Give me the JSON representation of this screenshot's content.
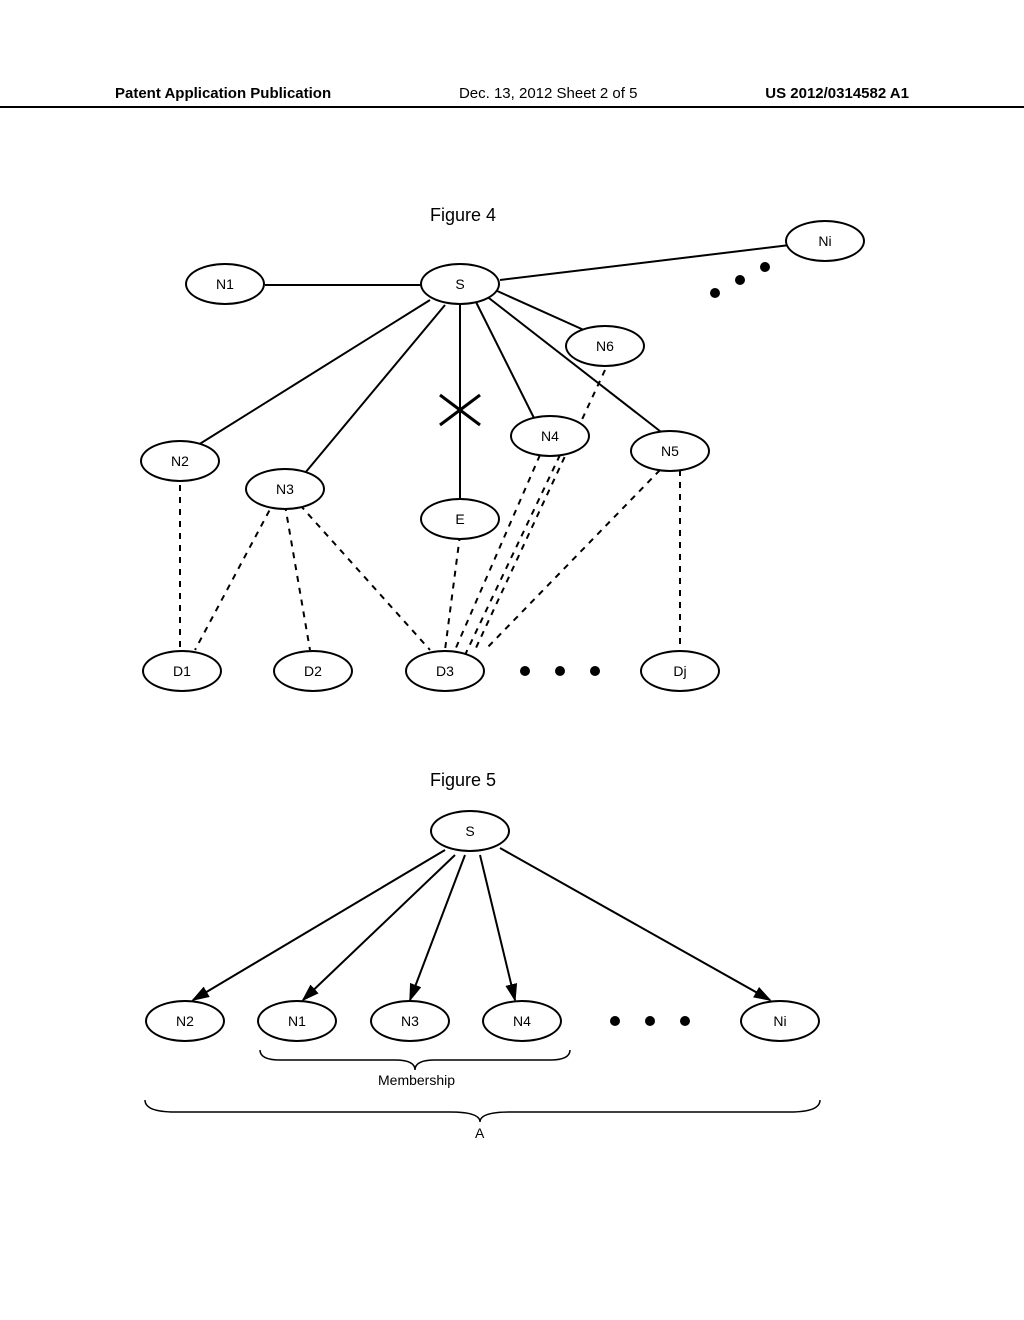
{
  "header": {
    "left": "Patent Application Publication",
    "center": "Dec. 13, 2012  Sheet 2 of 5",
    "right": "US 2012/0314582 A1"
  },
  "figure4": {
    "title": "Figure 4",
    "nodes": {
      "S": "S",
      "N1": "N1",
      "N2": "N2",
      "N3": "N3",
      "N4": "N4",
      "N5": "N5",
      "N6": "N6",
      "Ni": "Ni",
      "E": "E",
      "D1": "D1",
      "D2": "D2",
      "D3": "D3",
      "Dj": "Dj"
    }
  },
  "figure5": {
    "title": "Figure 5",
    "nodes": {
      "S": "S",
      "N1": "N1",
      "N2": "N2",
      "N3": "N3",
      "N4": "N4",
      "Ni": "Ni"
    },
    "labels": {
      "membership": "Membership",
      "A": "A"
    }
  }
}
